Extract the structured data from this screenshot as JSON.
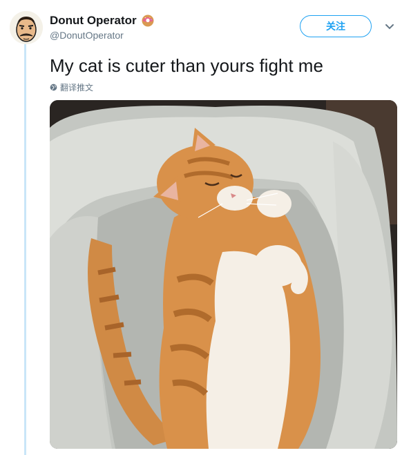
{
  "tweet": {
    "display_name": "Donut Operator",
    "handle": "@DonutOperator",
    "follow_label": "关注",
    "text": "My cat is cuter than yours fight me",
    "translate_label": "翻译推文"
  },
  "icons": {
    "avatar": "cartoon-man-avatar",
    "name_emoji": "donut-icon",
    "menu": "chevron-down-icon",
    "translate": "globe-icon"
  },
  "colors": {
    "accent": "#1da1f2",
    "text": "#14171a",
    "muted": "#657786",
    "thread": "#c9e6f8"
  },
  "media": {
    "alt": "Orange and white cat sleeping on its back in a gray cushioned pet bed"
  }
}
